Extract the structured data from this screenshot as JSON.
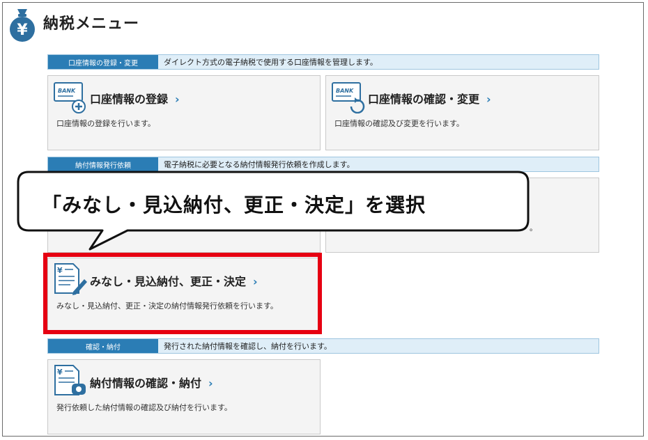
{
  "header": {
    "title": "納税メニュー",
    "icon": "yen-moneybag-icon"
  },
  "sections": [
    {
      "tag": "口座情報の登録・変更",
      "desc": "ダイレクト方式の電子納税で使用する口座情報を管理します。"
    },
    {
      "tag": "納付情報発行依頼",
      "desc": "電子納税に必要となる納付情報発行依頼を作成します。"
    },
    {
      "tag": "確認・納付",
      "desc": "発行された納付情報を確認し、納付を行います。"
    }
  ],
  "cards": {
    "register": {
      "title": "口座情報の登録",
      "desc": "口座情報の登録を行います。",
      "icon": "bank-card-add-icon"
    },
    "confirm": {
      "title": "口座情報の確認・変更",
      "desc": "口座情報の確認及び変更を行います。",
      "icon": "bank-card-refresh-icon"
    },
    "hidden_desc_tail": "。",
    "minashi": {
      "title": "みなし・見込納付、更正・決定",
      "desc": "みなし・見込納付、更正・決定の納付情報発行依頼を行います。",
      "icon": "yen-document-pen-icon"
    },
    "payment": {
      "title": "納付情報の確認・納付",
      "desc": "発行依頼した納付情報の確認及び納付を行います。",
      "icon": "yen-document-phone-icon"
    }
  },
  "arrow": "›",
  "callout": {
    "text": "「みなし・見込納付、更正・決定」を選択"
  },
  "colors": {
    "accent": "#2b7db5",
    "highlight": "#e60012",
    "section_bg": "#dfeef8"
  }
}
